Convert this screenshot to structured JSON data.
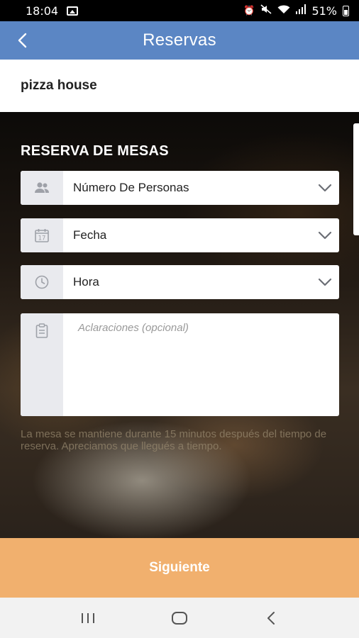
{
  "status_bar": {
    "time": "18:04",
    "battery": "51%",
    "icons": [
      "gallery-icon",
      "alarm-icon",
      "mute-icon",
      "wifi-icon",
      "signal-icon",
      "battery-icon"
    ]
  },
  "app_bar": {
    "title": "Reservas",
    "back_icon": "chevron-left-icon",
    "color": "#5b86c4"
  },
  "restaurant": {
    "name": "pizza house"
  },
  "form": {
    "section_title": "RESERVA DE MESAS",
    "persons": {
      "label": "Número De Personas",
      "icon": "people-icon"
    },
    "date": {
      "label": "Fecha",
      "icon": "calendar-icon",
      "calendar_day": "17"
    },
    "time": {
      "label": "Hora",
      "icon": "clock-icon"
    },
    "notes": {
      "placeholder": "Aclaraciones (opcional)",
      "icon": "notes-icon"
    },
    "notice": "La mesa se mantiene durante 15 minutos después del tiempo de reserva. Apreciamos que llegués a tiempo."
  },
  "next_button": {
    "label": "Siguiente",
    "color": "#f1b06e"
  },
  "nav_bar": {
    "buttons": [
      "recent-apps-icon",
      "home-icon",
      "back-icon"
    ]
  }
}
